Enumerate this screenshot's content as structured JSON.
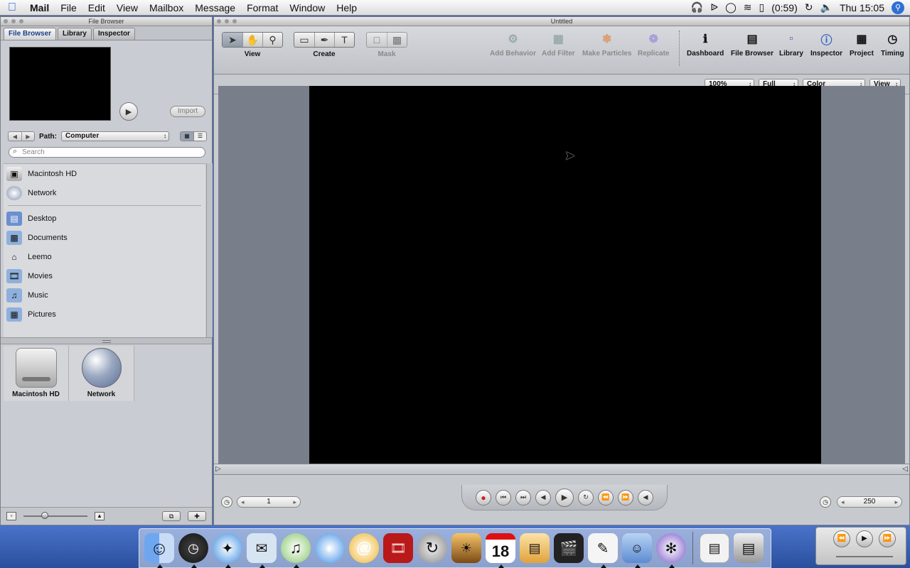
{
  "menubar": {
    "app": "Mail",
    "items": [
      "File",
      "Edit",
      "View",
      "Mailbox",
      "Message",
      "Format",
      "Window",
      "Help"
    ],
    "battery": "(0:59)",
    "clock": "Thu 15:05"
  },
  "left_window": {
    "title": "File Browser",
    "tabs": [
      "File Browser",
      "Library",
      "Inspector"
    ],
    "import_label": "Import",
    "path_label": "Path:",
    "path_value": "Computer",
    "search_placeholder": "Search",
    "devices": [
      "Macintosh HD",
      "Network"
    ],
    "places": [
      "Desktop",
      "Documents",
      "Leemo",
      "Movies",
      "Music",
      "Pictures"
    ],
    "grid_items": [
      "Macintosh HD",
      "Network"
    ]
  },
  "main_window": {
    "title": "Untitled",
    "groups": {
      "view": "View",
      "create": "Create",
      "mask": "Mask"
    },
    "actions": [
      "Add Behavior",
      "Add Filter",
      "Make Particles",
      "Replicate"
    ],
    "panels": [
      "Dashboard",
      "File Browser",
      "Library",
      "Inspector",
      "Project",
      "Timing"
    ],
    "zoom": "100%",
    "resolution": "Full",
    "channels": "Color",
    "view_menu": "View",
    "current_frame": "1",
    "end_frame": "250"
  },
  "dock": {
    "items": [
      "finder-icon",
      "dashboard-icon",
      "safari-icon",
      "mail-icon",
      "itunes-icon",
      "ichat-icon",
      "address-icon",
      "dvd-icon",
      "sync-icon",
      "iphoto-icon",
      "ical-icon",
      "preview-icon",
      "fcp-icon",
      "textedit-icon",
      "finder2-icon",
      "motion-icon",
      "document-icon",
      "trash-icon"
    ],
    "ical_date": "18"
  },
  "colors": {
    "accent": "#2e6fd6",
    "canvas": "#000000",
    "stage": "#797f8a"
  }
}
